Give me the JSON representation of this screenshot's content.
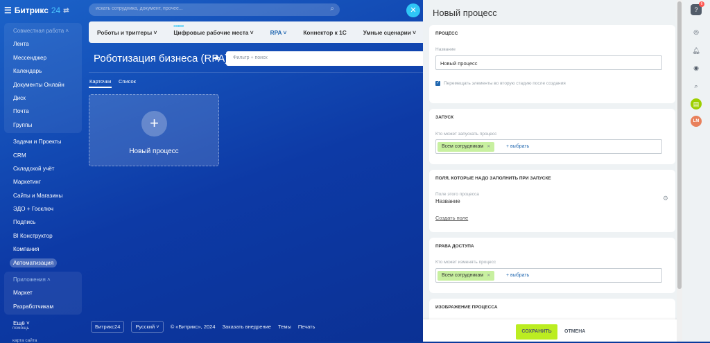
{
  "app": {
    "logo": "Битрикс",
    "logo_num": "24",
    "search_placeholder": "искать сотрудника, документ, прочее..."
  },
  "sidebar": {
    "group1_title": "Совместная работа",
    "group1": [
      "Лента",
      "Мессенджер",
      "Календарь",
      "Документы Онлайн",
      "Диск",
      "Почта",
      "Группы"
    ],
    "items": [
      "Задачи и Проекты",
      "CRM",
      "Складской учёт",
      "Маркетинг",
      "Сайты и Магазины",
      "ЭДО + Госключ",
      "Подпись",
      "BI Конструктор",
      "Компания",
      "Автоматизация"
    ],
    "group2_title": "Приложения",
    "group2": [
      "Маркет",
      "Разработчикам"
    ],
    "more": "Ещё",
    "help": "помощь",
    "cut": "карта сайта"
  },
  "tabs": [
    "Роботы и триггеры",
    "Цифровые рабочие места",
    "RPA",
    "Коннектор к 1С",
    "Умные сценарии"
  ],
  "tab_new_badge": "новое",
  "main": {
    "title": "Роботизация бизнеса (RPA)",
    "filter_placeholder": "Фильтр + поиск",
    "subtab1": "Карточки",
    "subtab2": "Список",
    "card_label": "Новый процесс"
  },
  "footer": {
    "brand": "Битрикс24",
    "lang": "Русский",
    "copyright": "© «Битрикс», 2024",
    "order": "Заказать внедрение",
    "themes": "Темы",
    "print": "Печать"
  },
  "panel": {
    "title": "Новый процесс",
    "s1_head": "Процесс",
    "s1_label": "Название",
    "s1_value": "Новый процесс",
    "s1_check": "Перемещать элементы во вторую стадию после создания",
    "s2_head": "Запуск",
    "s2_label": "Кто может запускать процесс",
    "s2_tag": "Всем сотрудникам",
    "s2_add": "+ выбрать",
    "s3_head": "Поля, которые надо заполнить при запуске",
    "s3_label": "Поле этого процесса",
    "s3_value": "Название",
    "s3_create": "Создать поле",
    "s4_head": "Права доступа",
    "s4_label": "Кто может изменять процесс",
    "s4_tag": "Всем сотрудникам",
    "s4_add": "+ выбрать",
    "s5_head": "Изображение процесса",
    "save": "СОХРАНИТЬ",
    "cancel": "ОТМЕНА"
  },
  "right_bar": {
    "badge": "6",
    "avatar": "LM"
  },
  "colors": {
    "accent": "#2fc6f6",
    "save": "#bbed21",
    "tag": "#c8f0a0"
  }
}
